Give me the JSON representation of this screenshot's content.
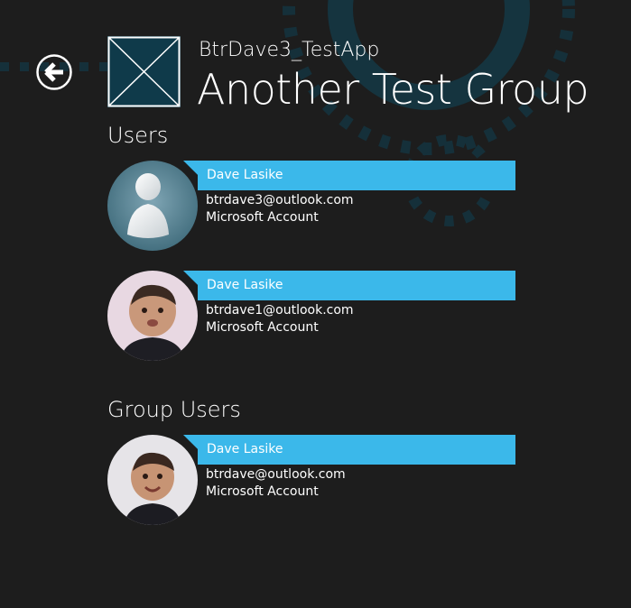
{
  "header": {
    "app_name": "BtrDave3_TestApp",
    "group_title": "Another Test Group",
    "back_icon": "back-arrow-icon",
    "group_image_icon": "placeholder-image-icon"
  },
  "sections": {
    "users_heading": "Users",
    "group_users_heading": "Group Users"
  },
  "users": [
    {
      "name": "Dave Lasike",
      "email": "btrdave3@outlook.com",
      "account_type": "Microsoft Account",
      "avatar": "default-person-avatar"
    },
    {
      "name": "Dave Lasike",
      "email": "btrdave1@outlook.com",
      "account_type": "Microsoft Account",
      "avatar": "baby-photo-avatar"
    }
  ],
  "group_users": [
    {
      "name": "Dave Lasike",
      "email": "btrdave@outlook.com",
      "account_type": "Microsoft Account",
      "avatar": "baby-photo-avatar"
    }
  ],
  "colors": {
    "background": "#1d1d1d",
    "accent": "#3bb8ea",
    "tile": "#0f3a4a",
    "decoration": "#14323d"
  }
}
